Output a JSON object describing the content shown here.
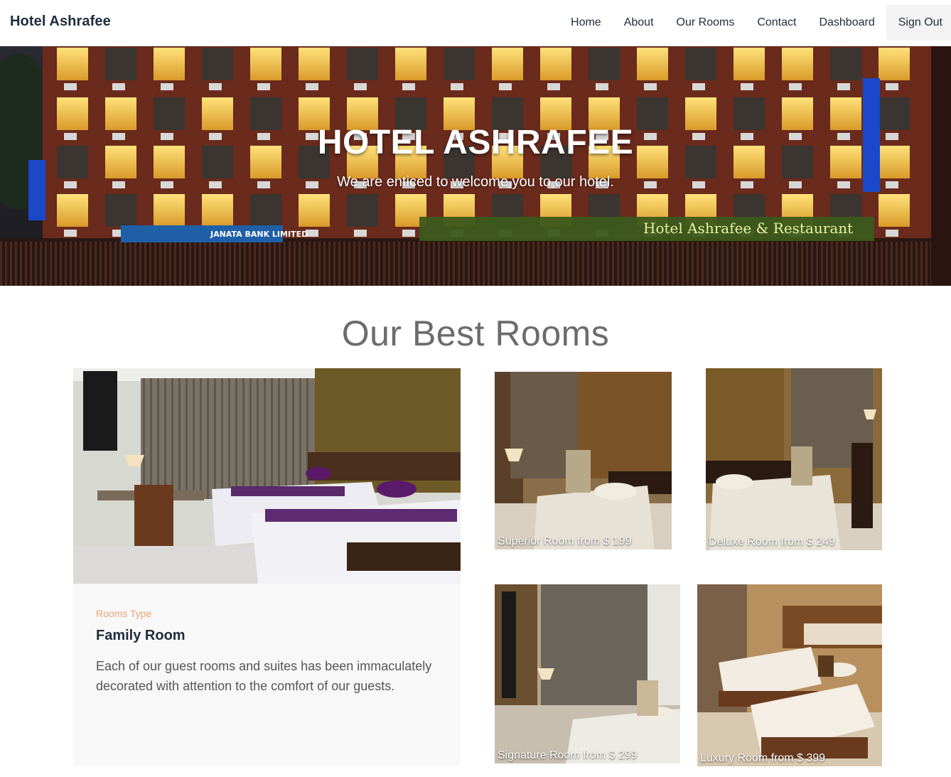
{
  "nav": {
    "brand": "Hotel Ashrafee",
    "links": [
      "Home",
      "About",
      "Our Rooms",
      "Contact",
      "Dashboard",
      "Sign Out"
    ]
  },
  "hero": {
    "title": "HOTEL ASHRAFEE",
    "subtitle": "We are enticed to welcome you to our hotel.",
    "signboard_main": "Hotel Ashrafee & Restaurant",
    "signboard_bank": "JANATA BANK LIMITED"
  },
  "rooms_section": {
    "title": "Our Best Rooms",
    "featured": {
      "type_label": "Rooms Type",
      "name": "Family Room",
      "description": "Each of our guest rooms and suites has been immaculately decorated with attention to the comfort of our guests."
    },
    "tiles": [
      {
        "caption": "Superior Room from $ 199"
      },
      {
        "caption": "Deluxe Room from $ 249"
      },
      {
        "caption": "Signature Room from $ 299"
      },
      {
        "caption": "Luxury Room from $ 399"
      }
    ]
  },
  "colors": {
    "accent": "#f0a078",
    "nav_text": "#1f2d3d",
    "card_bg": "#f8f8f8",
    "section_title": "#6c6c6c"
  }
}
